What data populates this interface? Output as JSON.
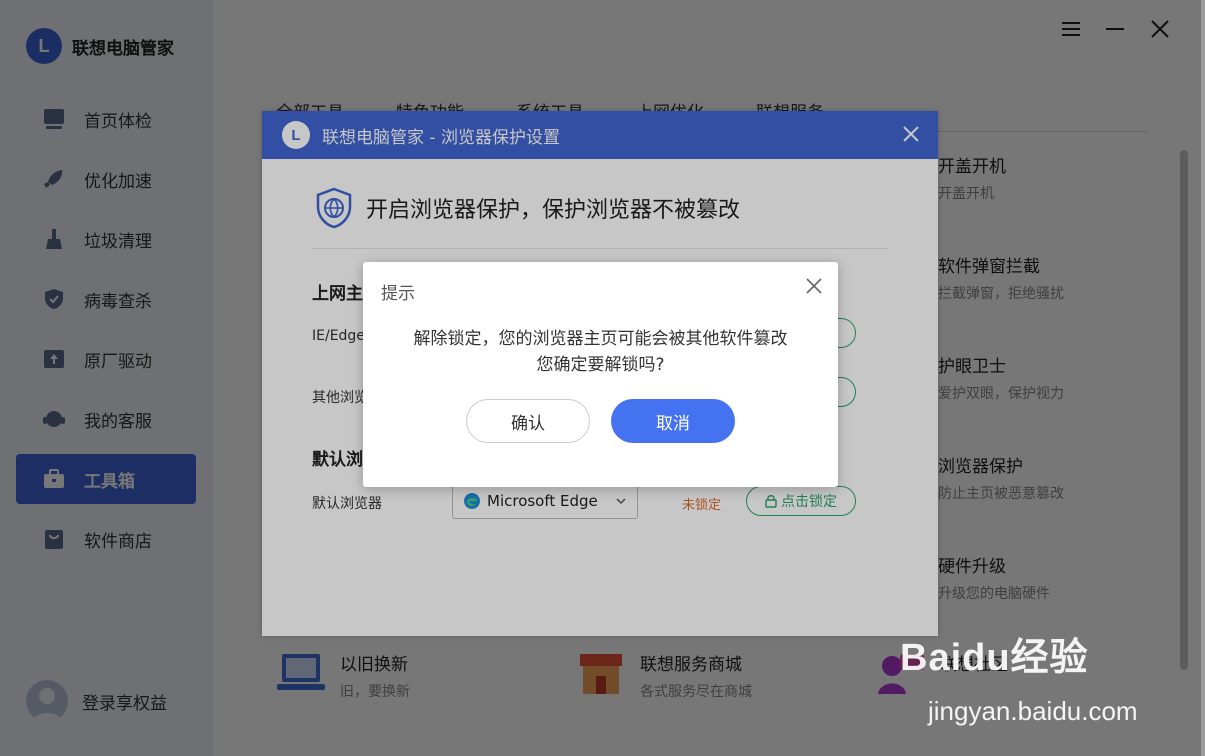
{
  "app": {
    "brand": "联想电脑管家",
    "sidebar": [
      {
        "label": "首页体检",
        "icon": "monitor-icon"
      },
      {
        "label": "优化加速",
        "icon": "rocket-icon"
      },
      {
        "label": "垃圾清理",
        "icon": "broom-icon"
      },
      {
        "label": "病毒查杀",
        "icon": "shield-icon"
      },
      {
        "label": "原厂驱动",
        "icon": "upload-icon"
      },
      {
        "label": "我的客服",
        "icon": "headset-icon"
      },
      {
        "label": "工具箱",
        "icon": "toolbox-icon",
        "active": true
      },
      {
        "label": "软件商店",
        "icon": "store-icon"
      }
    ],
    "login_label": "登录享权益",
    "tabs": [
      "全部工具",
      "特色功能",
      "系统工具",
      "上网优化",
      "联想服务"
    ],
    "tools_right": [
      {
        "title": "开盖开机",
        "desc": "开盖开机"
      },
      {
        "title": "软件弹窗拦截",
        "desc": "拦截弹窗，拒绝骚扰"
      },
      {
        "title": "护眼卫士",
        "desc": "爱护双眼，保护视力"
      },
      {
        "title": "浏览器保护",
        "desc": "防止主页被恶意篡改"
      },
      {
        "title": "硬件升级",
        "desc": "升级您的电脑硬件"
      }
    ],
    "tools_bottom": [
      {
        "title": "以旧换新",
        "desc": "旧，要换新"
      },
      {
        "title": "联想服务商城",
        "desc": "各式服务尽在商城"
      },
      {
        "title": "联想社区",
        "desc": ""
      }
    ]
  },
  "browser_dialog": {
    "title": "联想电脑管家 - 浏览器保护设置",
    "hero": "开启浏览器保护，保护浏览器不被篡改",
    "section1": "上网主",
    "row1_label": "IE/Edge",
    "row2_label": "其他浏览",
    "section2": "默认浏",
    "default_browser_label": "默认浏览器",
    "default_browser_value": "Microsoft Edge",
    "status": "未锁定",
    "lock_button": "点击锁定"
  },
  "prompt": {
    "title": "提示",
    "message_line1": "解除锁定，您的浏览器主页可能会被其他软件篡改",
    "message_line2": "您确定要解锁吗?",
    "confirm": "确认",
    "cancel": "取消"
  },
  "watermark": {
    "brand": "Baidu经验",
    "url": "jingyan.baidu.com"
  }
}
